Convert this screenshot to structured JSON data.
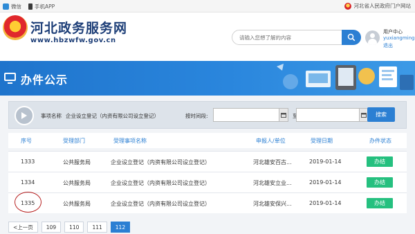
{
  "topbar": {
    "weibo": "微信",
    "mobile_app": "手机APP",
    "gov_portal": "河北省人民政府门户网站"
  },
  "header": {
    "site_title": "河北政务服务网",
    "site_url": "www.hbzwfw.gov.cn",
    "search_placeholder": "请输入您想了解的内容",
    "user_center": "用户中心",
    "username": "yuxiangming",
    "logout": "退出"
  },
  "banner": {
    "title": "办件公示"
  },
  "filter": {
    "item_name_label": "事项名称",
    "item_name_value": "企业设立登记（内资有限公司设立登记）",
    "time_label": "按时间段:",
    "to_label": "至：",
    "search_label": "搜索"
  },
  "table": {
    "headers": {
      "seq": "序号",
      "department": "受理部门",
      "item": "受理事项名称",
      "applicant": "申报人/单位",
      "date": "受理日期",
      "status": "办件状态"
    },
    "rows": [
      {
        "seq": "1333",
        "department": "公共服务局",
        "item": "企业设立登记（内资有限公司设立登记）",
        "applicant": "河北雄安百古...",
        "date": "2019-01-14",
        "status": "办结"
      },
      {
        "seq": "1334",
        "department": "公共服务局",
        "item": "企业设立登记（内资有限公司设立登记）",
        "applicant": "河北雄安立业...",
        "date": "2019-01-14",
        "status": "办结"
      },
      {
        "seq": "1335",
        "department": "公共服务局",
        "item": "企业设立登记（内资有限公司设立登记）",
        "applicant": "河北雄安保兴...",
        "date": "2019-01-14",
        "status": "办结"
      }
    ]
  },
  "pagination": {
    "prev": "<上一页",
    "pages": [
      "109",
      "110",
      "111",
      "112"
    ],
    "active": "112"
  },
  "colors": {
    "accent": "#2b7fd3",
    "status": "#25c07f",
    "title": "#1e3f78"
  }
}
